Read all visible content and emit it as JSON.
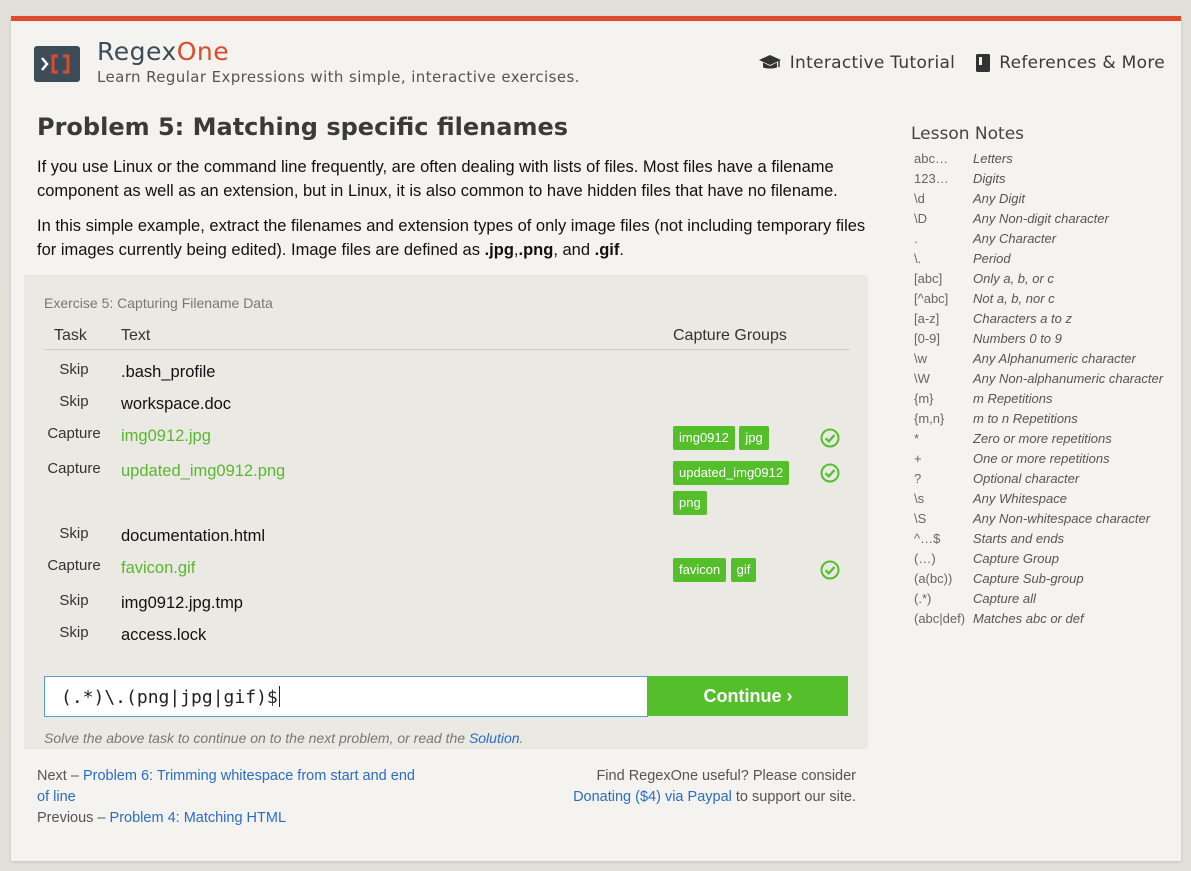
{
  "header": {
    "brand_main": "Regex",
    "brand_accent": "One",
    "tagline": "Learn Regular Expressions with simple, interactive exercises.",
    "nav": [
      {
        "label": "Interactive Tutorial",
        "icon": "graduation-cap-icon"
      },
      {
        "label": "References & More",
        "icon": "book-icon"
      }
    ]
  },
  "lesson": {
    "title": "Problem 5: Matching specific filenames",
    "paragraph1": "If you use Linux or the command line frequently, are often dealing with lists of files. Most files have a filename component as well as an extension, but in Linux, it is also common to have hidden files that have no filename.",
    "paragraph2_prefix": "In this simple example, extract the filenames and extension types of only image files (not including temporary files for images currently being edited). Image files are defined as ",
    "ext1": ".jpg",
    "ext2": ".png",
    "ext3": ".gif",
    "comma": ",",
    "and_text": ", and ",
    "period": "."
  },
  "exercise": {
    "title": "Exercise 5: Capturing Filename Data",
    "columns": {
      "task": "Task",
      "text": "Text",
      "groups": "Capture Groups"
    },
    "rows": [
      {
        "task": "Skip",
        "text": ".bash_profile",
        "matched": false,
        "groups": []
      },
      {
        "task": "Skip",
        "text": "workspace.doc",
        "matched": false,
        "groups": []
      },
      {
        "task": "Capture",
        "text": "img0912.jpg",
        "matched": true,
        "groups": [
          "img0912",
          "jpg"
        ]
      },
      {
        "task": "Capture",
        "text": "updated_img0912.png",
        "matched": true,
        "groups": [
          "updated_img0912",
          "png"
        ]
      },
      {
        "task": "Skip",
        "text": "documentation.html",
        "matched": false,
        "groups": []
      },
      {
        "task": "Capture",
        "text": "favicon.gif",
        "matched": true,
        "groups": [
          "favicon",
          "gif"
        ]
      },
      {
        "task": "Skip",
        "text": "img0912.jpg.tmp",
        "matched": false,
        "groups": []
      },
      {
        "task": "Skip",
        "text": "access.lock",
        "matched": false,
        "groups": []
      }
    ],
    "regex_value": "(.*)\\.(png|jpg|gif)$",
    "continue_label": "Continue ›",
    "hint_prefix": "Solve the above task to continue on to the next problem, or read the ",
    "hint_link": "Solution",
    "hint_suffix": "."
  },
  "footer": {
    "next_prefix": "Next – ",
    "next_link": "Problem 6: Trimming whitespace from start and end of line",
    "prev_prefix": "Previous – ",
    "prev_link": "Problem 4: Matching HTML",
    "support_text": "Find RegexOne useful? Please consider",
    "donate_link": "Donating ($4) via Paypal",
    "support_suffix": " to support our site."
  },
  "sidebar": {
    "title": "Lesson Notes",
    "notes": [
      {
        "k": "abc…",
        "v": "Letters"
      },
      {
        "k": "123…",
        "v": "Digits"
      },
      {
        "k": "\\d",
        "v": "Any Digit"
      },
      {
        "k": "\\D",
        "v": "Any Non-digit character"
      },
      {
        "k": ".",
        "v": "Any Character"
      },
      {
        "k": "\\.",
        "v": "Period"
      },
      {
        "k": "[abc]",
        "v": "Only a, b, or c"
      },
      {
        "k": "[^abc]",
        "v": "Not a, b, nor c"
      },
      {
        "k": "[a-z]",
        "v": "Characters a to z"
      },
      {
        "k": "[0-9]",
        "v": "Numbers 0 to 9"
      },
      {
        "k": "\\w",
        "v": "Any Alphanumeric character"
      },
      {
        "k": "\\W",
        "v": "Any Non-alphanumeric character"
      },
      {
        "k": "{m}",
        "v": "m Repetitions"
      },
      {
        "k": "{m,n}",
        "v": "m to n Repetitions"
      },
      {
        "k": "*",
        "v": "Zero or more repetitions"
      },
      {
        "k": "+",
        "v": "One or more repetitions"
      },
      {
        "k": "?",
        "v": "Optional character"
      },
      {
        "k": "\\s",
        "v": "Any Whitespace"
      },
      {
        "k": "\\S",
        "v": "Any Non-whitespace character"
      },
      {
        "k": "^…$",
        "v": "Starts and ends"
      },
      {
        "k": "(…)",
        "v": "Capture Group"
      },
      {
        "k": "(a(bc))",
        "v": "Capture Sub-group"
      },
      {
        "k": "(.*)",
        "v": "Capture all"
      },
      {
        "k": "(abc|def)",
        "v": "Matches abc or def"
      }
    ]
  },
  "colors": {
    "accent": "#de4a2b",
    "success": "#55bf2b",
    "link": "#2a6dc4"
  }
}
